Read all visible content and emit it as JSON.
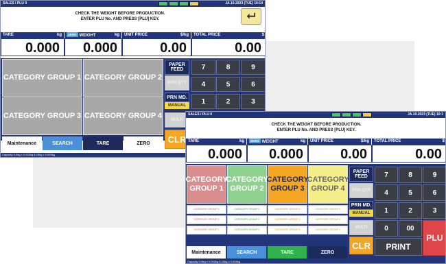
{
  "title_bar": {
    "left": "SALES / PLU 0",
    "date_a": "JA.10.2023 (TUE) 10:14",
    "date_b": "JA.10.2023 (TUE) 10:1"
  },
  "message": {
    "line1": "CHECK THE WEIGHT BEFORE PRODUCTION.",
    "line2": "ENTER PLU No. AND PRESS [PLU] KEY."
  },
  "headers": {
    "tare": "TARE",
    "tare_unit": "kg",
    "zero_badge": "ZERO",
    "weight": "WEIGHT",
    "weight_unit": "kg",
    "unit_price": "UNIT PRICE",
    "unit_price_unit": "$/kg",
    "total_price": "TOTAL PRICE",
    "total_price_unit": "$"
  },
  "values": {
    "tare": "0.000",
    "weight": "0.000",
    "unit_price": "0.00",
    "total_price": "0.00"
  },
  "categories": [
    "CATEGORY GROUP 1",
    "CATEGORY GROUP 2",
    "CATEGORY GROUP 3",
    "CATEGORY GROUP 4"
  ],
  "sub_categories": [
    "CATEGORY GROUP 1",
    "CATEGORY GROUP 2",
    "CATEGORY GROUP 3",
    "CATEGORY GROUP 4",
    "CATEGORY GROUP 1",
    "CATEGORY GROUP 2",
    "CATEGORY GROUP 3",
    "CATEGORY GROUP 4",
    "CATEGORY GROUP 1",
    "CATEGORY GROUP 2",
    "CATEGORY GROUP 3",
    "CATEGORY GROUP 4"
  ],
  "side_buttons": {
    "paper_feed": "PAPER FEED",
    "prn_qty": "PRN QTY",
    "prn_md": "PRN MD.",
    "manual": "MANUAL",
    "multi": "MULTI",
    "clr": "CLR"
  },
  "keys": {
    "k7": "7",
    "k8": "8",
    "k9": "9",
    "k4": "4",
    "k5": "5",
    "k6": "6",
    "k1": "1",
    "k2": "2",
    "k3": "3",
    "k0": "0",
    "k00": "00",
    "print": "PRINT",
    "plu": "PLU"
  },
  "footer": {
    "maintenance": "Maintenance",
    "search": "SEARCH",
    "tare": "TARE",
    "zero": "ZERO"
  },
  "capacity": "Capacity 0-6kg x 0.002kg 6-15kg x 0.005kg",
  "icons": [
    "scale-icon",
    "star-icon",
    "battery-icon",
    "network-icon"
  ],
  "colors": {
    "header_navy": "#23357a",
    "cat1": "#d98c8c",
    "cat2": "#8fd18f",
    "cat3": "#f5a623",
    "cat4": "#f5f08a",
    "plu_red": "#e0454a",
    "tare_green": "#2fb34a",
    "search_blue": "#4a90d9"
  }
}
